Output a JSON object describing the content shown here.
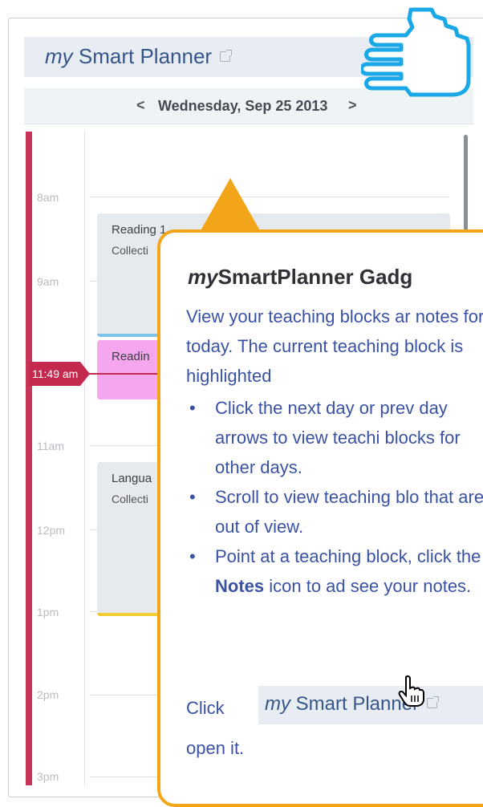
{
  "gadget": {
    "title_prefix": "my",
    "title_rest": " Smart Planner",
    "date": "Wednesday, Sep 25 2013",
    "prev_symbol": "<",
    "next_symbol": ">"
  },
  "timeline": {
    "labels": [
      "8am",
      "9am",
      "11am",
      "12pm",
      "1pm",
      "2pm",
      "3pm"
    ],
    "current_time": "11:49 am"
  },
  "blocks": [
    {
      "title": "Reading 1",
      "subtitle": "Collecti"
    },
    {
      "title": "Readin",
      "subtitle": ""
    },
    {
      "title": "Langua",
      "subtitle": "Collecti"
    }
  ],
  "callout": {
    "title_prefix": "my",
    "title_rest": "SmartPlanner Gadg",
    "intro": "View your teaching blocks ar notes for today. The current teaching block is highlighted",
    "items": [
      {
        "text": "Click the next day or prev day arrows to view teachi blocks for other days."
      },
      {
        "text": "Scroll to view teaching blo that are out of view."
      },
      {
        "before": "Point at a teaching block, click the ",
        "bold": "Notes",
        "after": " icon to ad see your notes."
      }
    ],
    "click_word": "Click",
    "button_prefix": "my",
    "button_rest": " Smart Planner",
    "open_text": "open it."
  },
  "colors": {
    "accent_orange": "#f3a51a",
    "timeline_red": "#c63558",
    "text_blue": "#3a52a4",
    "title_blue": "#36568a"
  }
}
